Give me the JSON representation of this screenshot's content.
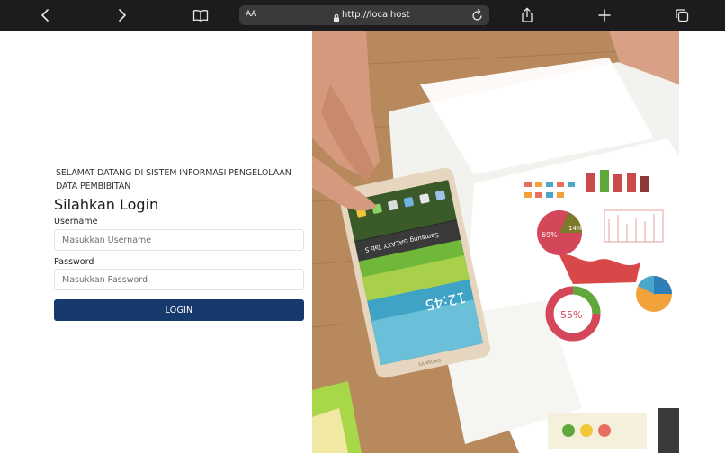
{
  "browser": {
    "url_text": "http://localhost",
    "text_size_label": "AA",
    "icons": [
      "back-icon",
      "forward-icon",
      "reader-icon",
      "lock-icon",
      "reload-icon",
      "share-icon",
      "new-tab-icon",
      "tabs-icon"
    ]
  },
  "login": {
    "welcome": "SELAMAT DATANG DI SISTEM INFORMASI PENGELOLAAN DATA PEMBIBITAN",
    "title": "Silahkan Login",
    "username_label": "Username",
    "username_placeholder": "Masukkan Username",
    "username_value": "",
    "password_label": "Password",
    "password_placeholder": "Masukkan Password",
    "password_value": "",
    "button_label": "LOGIN"
  },
  "photo": {
    "tablet_time": "12:45",
    "tablet_brand": "Samsung GALAXY Tab S",
    "tablet_footer": "SAMSUNG",
    "pie_label_a": "69%",
    "pie_label_b": "14%",
    "cycle_label": "55%"
  },
  "colors": {
    "toolbar_bg": "#1c1c1e",
    "urlbar_bg": "#3a3a3c",
    "button_bg": "#173a6e",
    "table_wood": "#b5865a"
  }
}
